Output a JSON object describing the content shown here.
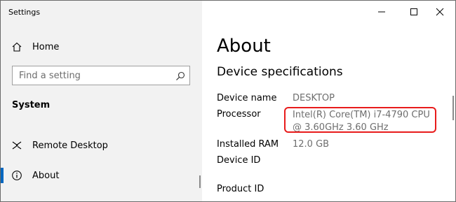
{
  "window": {
    "title": "Settings"
  },
  "sidebar": {
    "home_label": "Home",
    "search_placeholder": "Find a setting",
    "section_label": "System",
    "items": [
      {
        "label": "Remote Desktop",
        "icon": "remote-desktop-icon"
      },
      {
        "label": "About",
        "icon": "info-icon",
        "active": true
      }
    ]
  },
  "main": {
    "page_title": "About",
    "section_title": "Device specifications",
    "specs": [
      {
        "label": "Device name",
        "value": "DESKTOP"
      },
      {
        "label": "Processor",
        "value": "Intel(R) Core(TM) i7-4790 CPU @ 3.60GHz   3.60 GHz"
      },
      {
        "label": "Installed RAM",
        "value": "12.0 GB"
      },
      {
        "label": "Device ID",
        "value": ""
      },
      {
        "label": "Product ID",
        "value": ""
      }
    ]
  },
  "colors": {
    "accent": "#0067c0",
    "highlight": "#e81b1b",
    "sidebar_bg": "#f2f2f2"
  }
}
